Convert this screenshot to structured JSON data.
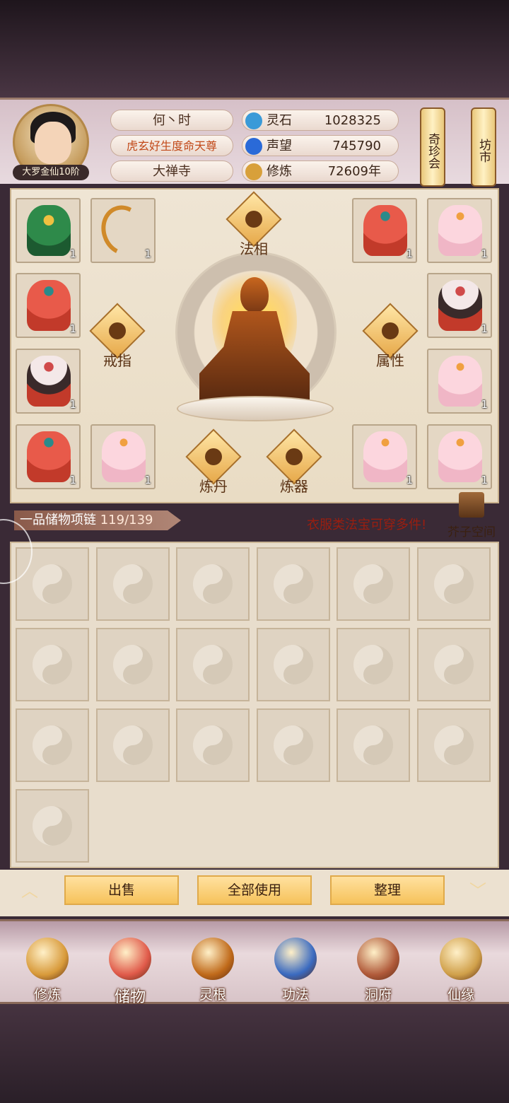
{
  "player": {
    "name": "何丶时",
    "title": "虎玄好生度命天尊",
    "sect": "大禅寺",
    "rank": "大罗金仙10阶"
  },
  "stats": [
    {
      "name": "灵石",
      "value": "1028325",
      "icon": "spirit-stone-icon",
      "color": "#3a9ad8"
    },
    {
      "name": "声望",
      "value": "745790",
      "icon": "prestige-icon",
      "color": "#2a6ad8"
    },
    {
      "name": "修炼",
      "value": "72609年",
      "icon": "cultivation-icon",
      "color": "#d8a03a"
    }
  ],
  "side_buttons": {
    "treasure_fair": "奇珍会",
    "market": "坊市"
  },
  "equipment": {
    "dharma_label": "法相",
    "ring_label": "戒指",
    "attr_label": "属性",
    "alchemy_label": "炼丹",
    "forge_label": "炼器",
    "slots": [
      {
        "qty": "1",
        "kind": "green"
      },
      {
        "qty": "1",
        "kind": "bow"
      },
      {
        "qty": "1",
        "kind": "red"
      },
      {
        "qty": "1",
        "kind": "pink"
      },
      {
        "qty": "1",
        "kind": "red"
      },
      {
        "qty": "1",
        "kind": "dark"
      },
      {
        "qty": "1",
        "kind": "dark"
      },
      {
        "qty": "1",
        "kind": "pink"
      },
      {
        "qty": "1",
        "kind": "red"
      },
      {
        "qty": "1",
        "kind": "pink"
      },
      {
        "qty": "1",
        "kind": "pink"
      },
      {
        "qty": "1",
        "kind": "pink"
      }
    ]
  },
  "bag": {
    "label": "一品储物项链",
    "count": "119/139",
    "hint": "衣服类法宝可穿多件!",
    "pocket_space": "芥子空间",
    "empty_cells": 19
  },
  "actions": {
    "sell": "出售",
    "use_all": "全部使用",
    "sort": "整理"
  },
  "nav": [
    {
      "label": "修炼",
      "icon": "cultivation-nav-icon",
      "color": "#d89a3a"
    },
    {
      "label": "储物",
      "icon": "storage-bag-icon",
      "color": "#e05a4a"
    },
    {
      "label": "灵根",
      "icon": "spirit-root-icon",
      "color": "#c06a1a"
    },
    {
      "label": "功法",
      "icon": "scripture-book-icon",
      "color": "#3a6ac0"
    },
    {
      "label": "洞府",
      "icon": "cave-dwelling-icon",
      "color": "#b05a3a"
    },
    {
      "label": "仙缘",
      "icon": "gourd-icon",
      "color": "#d0a04a"
    }
  ]
}
